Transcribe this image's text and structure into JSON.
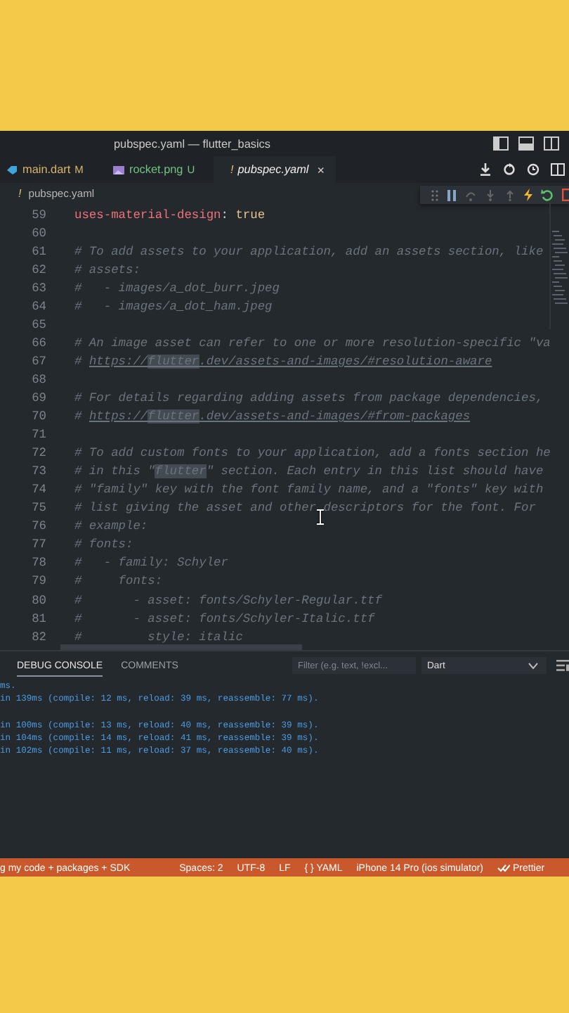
{
  "window": {
    "title": "pubspec.yaml — flutter_basics"
  },
  "tabs": [
    {
      "kind": "dart",
      "label": "main.dart",
      "status": "M",
      "color": "#d7b46a",
      "selected": false
    },
    {
      "kind": "image",
      "label": "rocket.png",
      "status": "U",
      "color": "#6fc27f",
      "selected": false
    },
    {
      "kind": "yaml",
      "glyph": "!",
      "label": "pubspec.yaml",
      "close": "×",
      "selected": true
    }
  ],
  "breadcrumb": {
    "glyph": "!",
    "label": "pubspec.yaml"
  },
  "editor": {
    "lines": [
      {
        "number": "59",
        "segments": [
          {
            "kind": "key",
            "text": "uses-material-design"
          },
          {
            "kind": "plain",
            "text": ": "
          },
          {
            "kind": "value",
            "text": "true"
          }
        ]
      },
      {
        "number": "60"
      },
      {
        "number": "61",
        "segments": [
          {
            "kind": "comment",
            "text": "# To add assets to your application, add an assets section, like"
          }
        ]
      },
      {
        "number": "62",
        "segments": [
          {
            "kind": "comment",
            "text": "# assets:"
          }
        ]
      },
      {
        "number": "63",
        "segments": [
          {
            "kind": "comment",
            "text": "#   - images/a_dot_burr.jpeg"
          }
        ]
      },
      {
        "number": "64",
        "segments": [
          {
            "kind": "comment",
            "text": "#   - images/a_dot_ham.jpeg"
          }
        ]
      },
      {
        "number": "65"
      },
      {
        "number": "66",
        "segments": [
          {
            "kind": "comment",
            "text": "# An image asset can refer to one or more resolution-specific \"va"
          }
        ]
      },
      {
        "number": "67",
        "segments": [
          {
            "kind": "comment",
            "text": "# "
          },
          {
            "kind": "link",
            "text": "https://"
          },
          {
            "kind": "link-highlight",
            "text": "flutter"
          },
          {
            "kind": "link",
            "text": ".dev/assets-and-images/#resolution-aware"
          }
        ]
      },
      {
        "number": "68"
      },
      {
        "number": "69",
        "segments": [
          {
            "kind": "comment",
            "text": "# For details regarding adding assets from package dependencies,"
          }
        ]
      },
      {
        "number": "70",
        "segments": [
          {
            "kind": "comment",
            "text": "# "
          },
          {
            "kind": "link",
            "text": "https://"
          },
          {
            "kind": "link-highlight",
            "text": "flutter"
          },
          {
            "kind": "link",
            "text": ".dev/assets-and-images/#from-packages"
          }
        ]
      },
      {
        "number": "71"
      },
      {
        "number": "72",
        "segments": [
          {
            "kind": "comment",
            "text": "# To add custom fonts to your application, add a fonts section he"
          }
        ]
      },
      {
        "number": "73",
        "segments": [
          {
            "kind": "comment",
            "text": "# in this \""
          },
          {
            "kind": "highlight",
            "text": "flutter"
          },
          {
            "kind": "comment",
            "text": "\" section. Each entry in this list should have"
          }
        ]
      },
      {
        "number": "74",
        "segments": [
          {
            "kind": "comment",
            "text": "# \"family\" key with the font family name, and a \"fonts\" key with"
          }
        ]
      },
      {
        "number": "75",
        "segments": [
          {
            "kind": "comment",
            "text": "# list giving the asset and other descriptors for the font. For"
          }
        ]
      },
      {
        "number": "76",
        "segments": [
          {
            "kind": "comment",
            "text": "# example:"
          }
        ]
      },
      {
        "number": "77",
        "segments": [
          {
            "kind": "comment",
            "text": "# fonts:"
          }
        ]
      },
      {
        "number": "78",
        "segments": [
          {
            "kind": "comment",
            "text": "#   - family: Schyler"
          }
        ]
      },
      {
        "number": "79",
        "segments": [
          {
            "kind": "comment",
            "text": "#     fonts:"
          }
        ]
      },
      {
        "number": "80",
        "segments": [
          {
            "kind": "comment",
            "text": "#       - asset: fonts/Schyler-Regular.ttf"
          }
        ]
      },
      {
        "number": "81",
        "segments": [
          {
            "kind": "comment",
            "text": "#       - asset: fonts/Schyler-Italic.ttf"
          }
        ]
      },
      {
        "number": "82",
        "segments": [
          {
            "kind": "comment",
            "text": "#         style: italic"
          }
        ]
      }
    ]
  },
  "panel": {
    "tabs": [
      {
        "label": "DEBUG CONSOLE",
        "selected": true
      },
      {
        "label": "COMMENTS",
        "selected": false
      }
    ],
    "filter": {
      "placeholder": "Filter (e.g. text, !excl..."
    },
    "dropdown": {
      "value": "Dart"
    },
    "console": [
      {
        "kind": "output",
        "text": "ms."
      },
      {
        "kind": "output",
        "text": "in 139ms (compile: 12 ms, reload: 39 ms, reassemble: 77 ms)."
      },
      {
        "kind": "blank"
      },
      {
        "kind": "output",
        "text": "in 100ms (compile: 13 ms, reload: 40 ms, reassemble: 39 ms)."
      },
      {
        "kind": "output",
        "text": "in 104ms (compile: 14 ms, reload: 41 ms, reassemble: 39 ms)."
      },
      {
        "kind": "output",
        "text": "in 102ms (compile: 11 ms, reload: 37 ms, reassemble: 40 ms)."
      }
    ]
  },
  "status_bar": [
    {
      "kind": "text",
      "text": "g my code + packages + SDK"
    },
    {
      "kind": "text",
      "text": "Spaces: 2"
    },
    {
      "kind": "text",
      "text": "UTF-8"
    },
    {
      "kind": "text",
      "text": "LF"
    },
    {
      "kind": "text",
      "text": "{ } YAML"
    },
    {
      "kind": "text",
      "text": "iPhone 14 Pro (ios simulator)"
    },
    {
      "kind": "prettier",
      "text": "Prettier"
    }
  ]
}
